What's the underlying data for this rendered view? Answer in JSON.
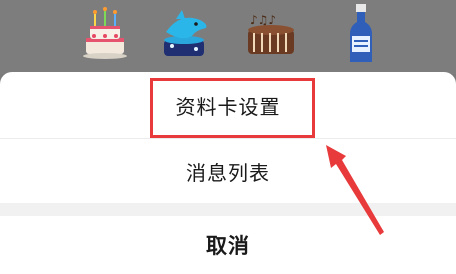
{
  "gifts": [
    {
      "name": "birthday-cake"
    },
    {
      "name": "dolphin-cake"
    },
    {
      "name": "music-cake"
    },
    {
      "name": "bottle"
    }
  ],
  "action_sheet": {
    "profile_card_settings": "资料卡设置",
    "message_list": "消息列表",
    "cancel": "取消"
  },
  "colors": {
    "highlight": "#e8393b",
    "backdrop": "#7a7a7a"
  }
}
